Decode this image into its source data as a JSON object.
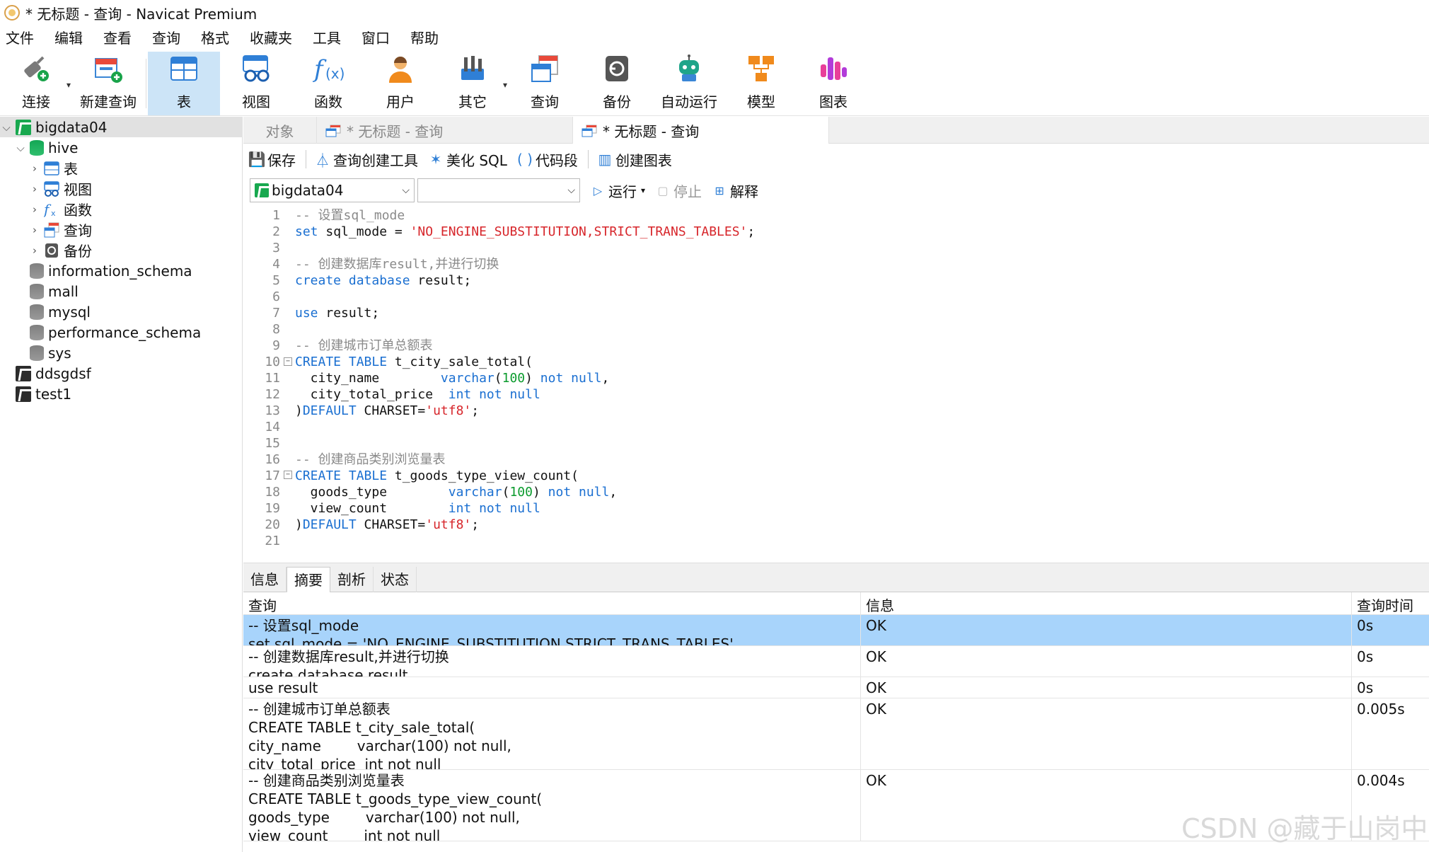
{
  "window": {
    "title": "* 无标题 - 查询 - Navicat Premium"
  },
  "menu": [
    "文件",
    "编辑",
    "查看",
    "查询",
    "格式",
    "收藏夹",
    "工具",
    "窗口",
    "帮助"
  ],
  "toolbar": [
    {
      "label": "连接",
      "icon": "connection-plug-icon",
      "dropdown": true
    },
    {
      "label": "新建查询",
      "icon": "new-query-icon",
      "dropdown": false
    },
    {
      "label": "表",
      "icon": "table-icon",
      "active": true
    },
    {
      "label": "视图",
      "icon": "view-glasses-icon"
    },
    {
      "label": "函数",
      "icon": "function-fx-icon"
    },
    {
      "label": "用户",
      "icon": "user-icon"
    },
    {
      "label": "其它",
      "icon": "tools-icon",
      "dropdown": true
    },
    {
      "label": "查询",
      "icon": "query-icon"
    },
    {
      "label": "备份",
      "icon": "backup-icon"
    },
    {
      "label": "自动运行",
      "icon": "robot-icon"
    },
    {
      "label": "模型",
      "icon": "model-icon"
    },
    {
      "label": "图表",
      "icon": "chart-icon"
    }
  ],
  "tree": {
    "connection": "bigdata04",
    "db_hive": "hive",
    "hive_children": [
      "表",
      "视图",
      "函数",
      "查询",
      "备份"
    ],
    "databases": [
      "information_schema",
      "mall",
      "mysql",
      "performance_schema",
      "sys"
    ],
    "other_connections": [
      "ddsgdsf",
      "test1"
    ]
  },
  "tabs": {
    "objects": "对象",
    "tab1": "* 无标题 - 查询",
    "tab2": "* 无标题 - 查询"
  },
  "query_toolbar": {
    "save": "保存",
    "builder": "查询创建工具",
    "beautify": "美化 SQL",
    "snippet": "代码段",
    "chart": "创建图表"
  },
  "selectors": {
    "connection": "bigdata04",
    "database": "",
    "run": "运行",
    "stop": "停止",
    "explain": "解释"
  },
  "line_numbers": [
    "1",
    "2",
    "3",
    "4",
    "5",
    "6",
    "7",
    "8",
    "9",
    "10",
    "11",
    "12",
    "13",
    "14",
    "15",
    "16",
    "17",
    "18",
    "19",
    "20",
    "21"
  ],
  "code": {
    "l1": "-- 设置sql_mode",
    "l2a": "set",
    "l2b": " sql_mode = ",
    "l2c": "'NO_ENGINE_SUBSTITUTION,STRICT_TRANS_TABLES'",
    "l2d": ";",
    "l4": "-- 创建数据库result,并进行切换",
    "l5a": "create database",
    "l5b": " result;",
    "l7a": "use",
    "l7b": " result;",
    "l9": "-- 创建城市订单总额表",
    "l10a": "CREATE TABLE",
    "l10b": " t_city_sale_total(",
    "l11a": "  city_name        ",
    "l11b": "varchar",
    "l11c": "(",
    "l11d": "100",
    "l11e": ")",
    "l11f": " not null",
    ",": ",",
    "l12a": "  city_total_price  ",
    "l12b": "int not null",
    "l13a": ")",
    "l13b": "DEFAULT",
    "l13c": " CHARSET=",
    "l13d": "'utf8'",
    "l13e": ";",
    "l16": "-- 创建商品类别浏览量表",
    "l17a": "CREATE TABLE",
    "l17b": " t_goods_type_view_count(",
    "l18a": "  goods_type        ",
    "l18b": "varchar",
    "l18c": "(",
    "l18d": "100",
    "l18e": ")",
    "l18f": " not null",
    "l19a": "  view_count        ",
    "l19b": "int not null",
    "l20a": ")",
    "l20b": "DEFAULT",
    "l20c": " CHARSET=",
    "l20d": "'utf8'",
    "l20e": ";"
  },
  "result_tabs": [
    "信息",
    "摘要",
    "剖析",
    "状态"
  ],
  "result_headers": [
    "查询",
    "信息",
    "查询时间"
  ],
  "result_rows": [
    {
      "query": "-- 设置sql_mode\nset sql_mode = 'NO_ENGINE_SUBSTITUTION,STRICT_TRANS_TABLES'",
      "info": "OK",
      "time": "0s"
    },
    {
      "query": "-- 创建数据库result,并进行切换\ncreate database result",
      "info": "OK",
      "time": "0s"
    },
    {
      "query": "use result",
      "info": "OK",
      "time": "0s"
    },
    {
      "query": "-- 创建城市订单总额表\nCREATE TABLE t_city_sale_total(\ncity_name        varchar(100) not null,\ncity_total_price  int not null",
      "info": "OK",
      "time": "0.005s"
    },
    {
      "query": "-- 创建商品类别浏览量表\nCREATE TABLE t_goods_type_view_count(\ngoods_type        varchar(100) not null,\nview_count        int not null",
      "info": "OK",
      "time": "0.004s"
    }
  ],
  "watermark": "CSDN @藏于山岗中",
  "colors": {
    "selection": "#a8d4fb",
    "active_tool": "#cce4f7",
    "keyword": "#1a6fd1",
    "string": "#d7262b",
    "comment": "#8a8a8a",
    "number": "#0c9b2e"
  }
}
